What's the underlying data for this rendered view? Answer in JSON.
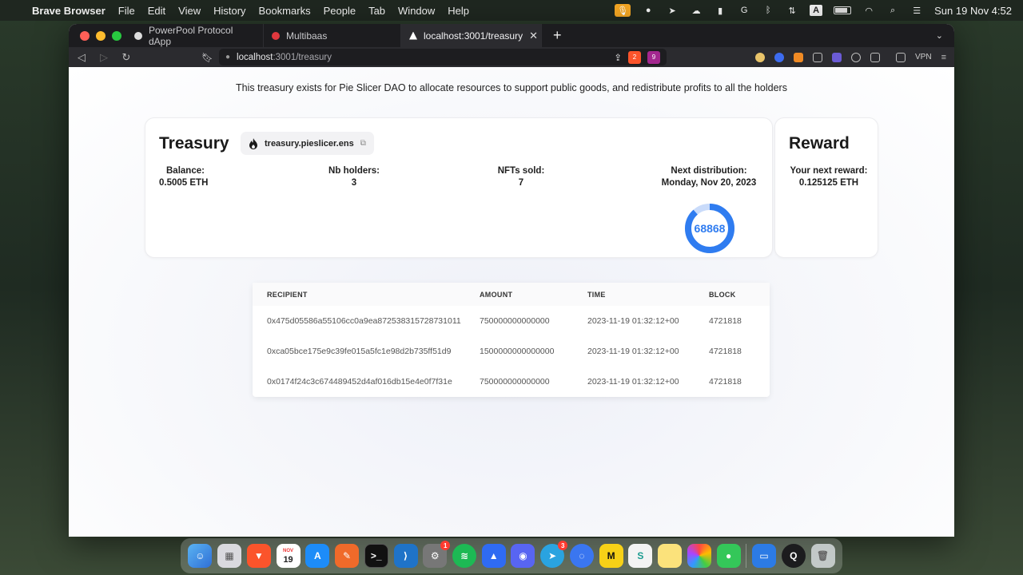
{
  "menubar": {
    "app_name": "Brave Browser",
    "menus": [
      "File",
      "Edit",
      "View",
      "History",
      "Bookmarks",
      "People",
      "Tab",
      "Window",
      "Help"
    ],
    "clock": "Sun 19 Nov  4:52",
    "input_source": "A"
  },
  "tabs": [
    {
      "title": "PowerPool Protocol dApp",
      "favicon_color": "#dddddd"
    },
    {
      "title": "Multibaas",
      "favicon_color": "#e0383e"
    },
    {
      "title": "localhost:3001/treasury",
      "favicon_color": "#ffffff"
    }
  ],
  "address_bar": {
    "host": "localhost",
    "path": ":3001/treasury",
    "shield_count": "2",
    "rewards_count": "9"
  },
  "toolbar": {
    "vpn_label": "VPN"
  },
  "page": {
    "intro": "This treasury exists for Pie Slicer DAO to allocate resources to support public goods, and redistribute profits to all the holders",
    "treasury": {
      "title": "Treasury",
      "ens": "treasury.pieslicer.ens",
      "balance_label": "Balance:",
      "balance_value": "0.5005 ETH",
      "holders_label": "Nb holders:",
      "holders_value": "3",
      "nfts_label": "NFTs sold:",
      "nfts_value": "7",
      "next_label": "Next distribution:",
      "next_value": "Monday, Nov 20, 2023",
      "countdown_text": "68868"
    },
    "reward": {
      "title": "Reward",
      "label": "Your next reward:",
      "value": "0.125125 ETH"
    },
    "table": {
      "headers": [
        "RECIPIENT",
        "AMOUNT",
        "TIME",
        "BLOCK"
      ],
      "rows": [
        [
          "0x475d05586a55106cc0a9ea872538315728731011",
          "750000000000000",
          "2023-11-19 01:32:12+00",
          "4721818"
        ],
        [
          "0xca05bce175e9c39fe015a5fc1e98d2b735ff51d9",
          "1500000000000000",
          "2023-11-19 01:32:12+00",
          "4721818"
        ],
        [
          "0x0174f24c3c674489452d4af016db15e4e0f7f31e",
          "750000000000000",
          "2023-11-19 01:32:12+00",
          "4721818"
        ]
      ]
    }
  },
  "dock": {
    "calendar_month": "NOV",
    "calendar_day": "19",
    "badges": {
      "system_settings": "1",
      "telegram": "3"
    }
  }
}
